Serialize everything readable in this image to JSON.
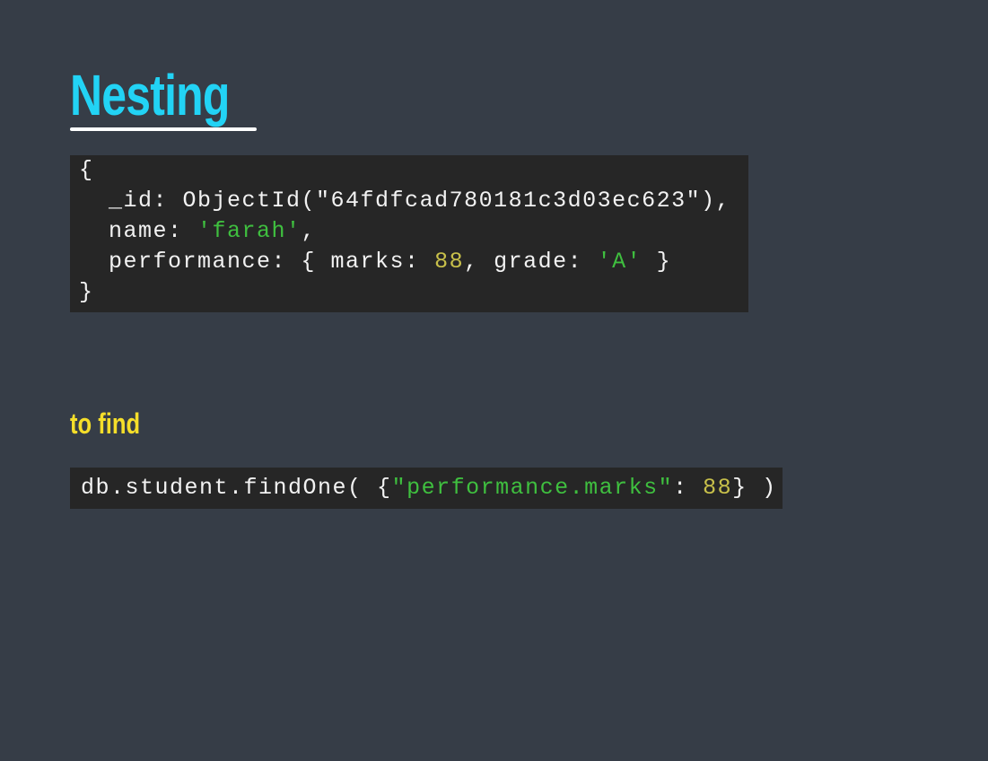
{
  "slide": {
    "title": "Nesting",
    "subtitle": "to find",
    "colors": {
      "title": "#22d3f5",
      "subtitle": "#f5de2a",
      "string": "#3fbf3f",
      "number": "#c8c04a",
      "code_bg": "#262626",
      "background": "#363d47"
    }
  },
  "document_code": {
    "open": "{",
    "id_key": "  _id: ObjectId(",
    "id_value": "\"64fdfcad780181c3d03ec623\"",
    "id_end": "),",
    "name_key": "  name: ",
    "name_value": "'farah'",
    "name_end": ",",
    "perf_key": "  performance: { marks: ",
    "marks_value": "88",
    "grade_key": ", grade: ",
    "grade_value": "'A'",
    "perf_end": " }",
    "close": "}"
  },
  "query_code": {
    "prefix": "db.student.findOne( {",
    "key": "\"performance.marks\"",
    "colon": ": ",
    "value": "88",
    "suffix": "} )"
  }
}
